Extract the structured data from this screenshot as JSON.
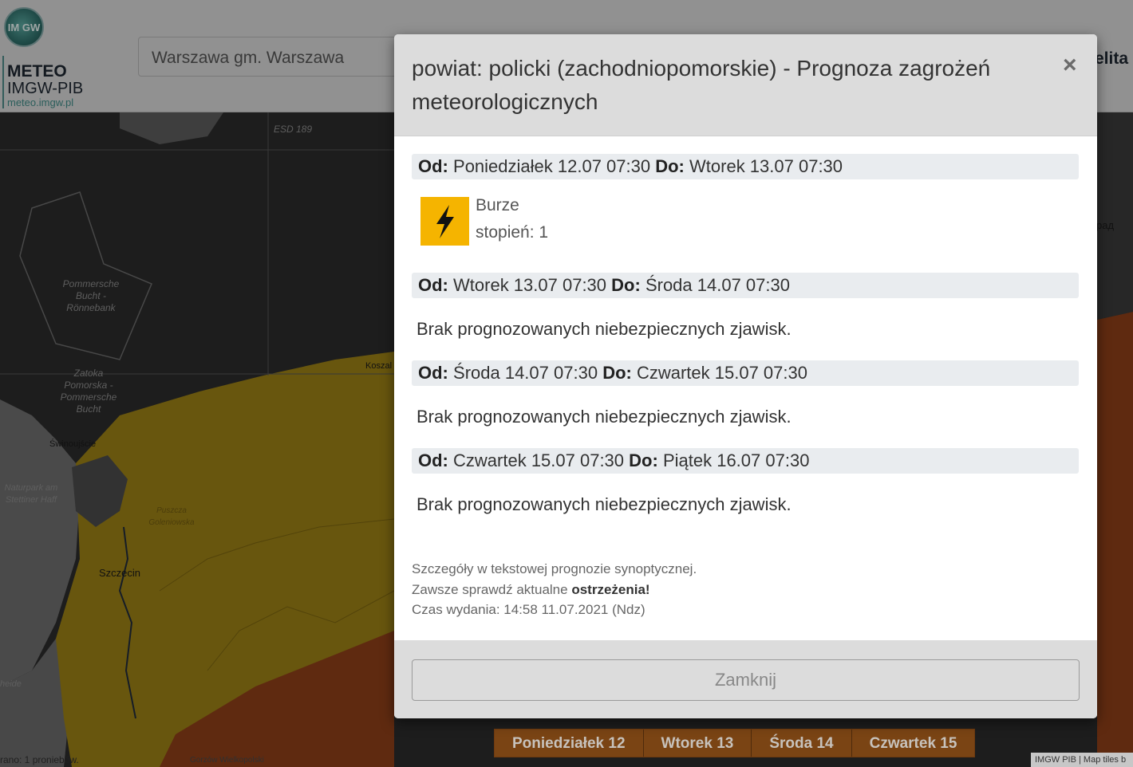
{
  "header": {
    "logo_text": "IM GW",
    "brand_meteo": "METEO",
    "brand_imgw": "IMGW-PIB",
    "brand_url": "meteo.imgw.pl",
    "search_value": "Warszawa gm. Warszawa",
    "right_text": "elita"
  },
  "map": {
    "labels": {
      "esd": "ESD 189",
      "pommersche_bucht": "Pommersche Bucht - Rönnebank",
      "zatoka": "Zatoka Pomorska - Pommersche Bucht",
      "naturpark": "Naturpark am Stettiner Haff",
      "puszcza": "Puszcza Goleniowska",
      "heide": "heide",
      "rad": "рад",
      "koszalin": "Koszal"
    },
    "cities": {
      "swinoujscie": "Świnoujście",
      "szczecin": "Szczecin"
    },
    "bottom_left": "rano: 1 proniebów.",
    "bottom_mid": "Gorzów Wielkopolski",
    "bottom_right": "IMGW PIB | Map tiles b"
  },
  "day_bar": [
    "Poniedziałek 12",
    "Wtorek 13",
    "Środa 14",
    "Czwartek 15"
  ],
  "modal": {
    "title": "powiat: policki (zachodniopomorskie) - Prognoza zagrożeń meteorologicznych",
    "close_symbol": "×",
    "from_label": "Od:",
    "to_label": "Do:",
    "periods": [
      {
        "from": "Poniedziałek 12.07 07:30",
        "to": "Wtorek 13.07 07:30"
      },
      {
        "from": "Wtorek 13.07 07:30",
        "to": "Środa 14.07 07:30"
      },
      {
        "from": "Środa 14.07 07:30",
        "to": "Czwartek 15.07 07:30"
      },
      {
        "from": "Czwartek 15.07 07:30",
        "to": "Piątek 16.07 07:30"
      }
    ],
    "hazard": {
      "icon": "lightning-icon",
      "name": "Burze",
      "level": "stopień: 1",
      "color": "#f5b400"
    },
    "no_hazard_text": "Brak prognozowanych niebezpiecznych zjawisk.",
    "footer_notes": {
      "details": "Szczegóły w tekstowej prognozie synoptycznej.",
      "check_prefix": "Zawsze sprawdź aktualne",
      "check_link": "ostrzeżenia!",
      "issued": "Czas wydania: 14:58 11.07.2021 (Ndz)"
    },
    "close_button": "Zamknij"
  }
}
